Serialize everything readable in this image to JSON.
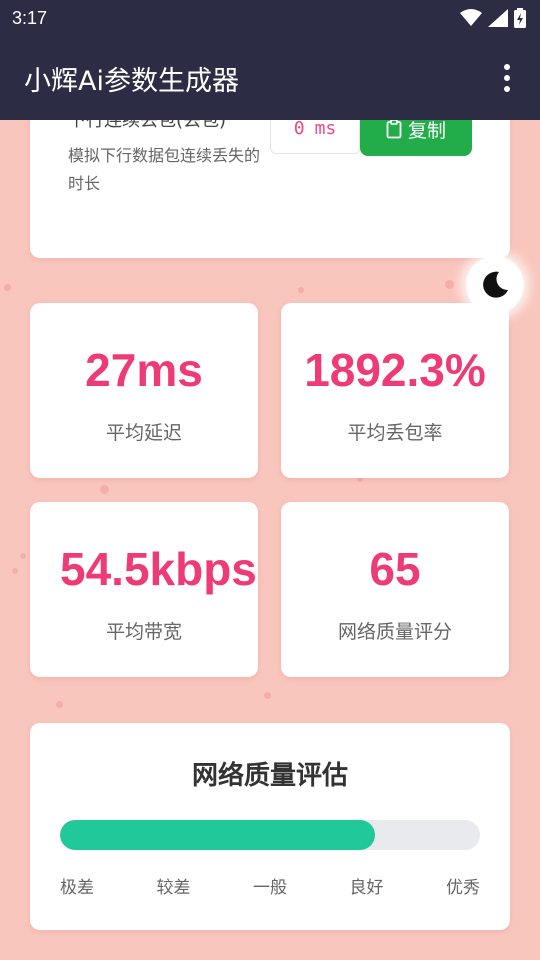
{
  "status": {
    "time": "3:17"
  },
  "appbar": {
    "title": "小辉Ai参数生成器"
  },
  "top_card": {
    "title_partial": "下行连续丢包(丢包)",
    "description": "模拟下行数据包连续丢失的时长",
    "input_value": "0",
    "input_unit": "ms",
    "copy_label": "复制"
  },
  "stats": [
    {
      "value": "27ms",
      "label": "平均延迟"
    },
    {
      "value": "1892.3%",
      "label": "平均丢包率"
    },
    {
      "value": "54.5kbps",
      "label": "平均带宽"
    },
    {
      "value": "65",
      "label": "网络质量评分"
    }
  ],
  "evaluation": {
    "title": "网络质量评估",
    "progress_percent": 75,
    "levels": [
      "极差",
      "较差",
      "一般",
      "良好",
      "优秀"
    ]
  },
  "colors": {
    "appbar": "#2c2d45",
    "background": "#f9c6bd",
    "accent": "#ee3b76",
    "copy_button": "#22ad4a",
    "progress": "#20c997"
  },
  "icons": [
    "wifi-icon",
    "signal-icon",
    "battery-icon",
    "more-vert-icon",
    "clipboard-icon",
    "moon-icon"
  ]
}
